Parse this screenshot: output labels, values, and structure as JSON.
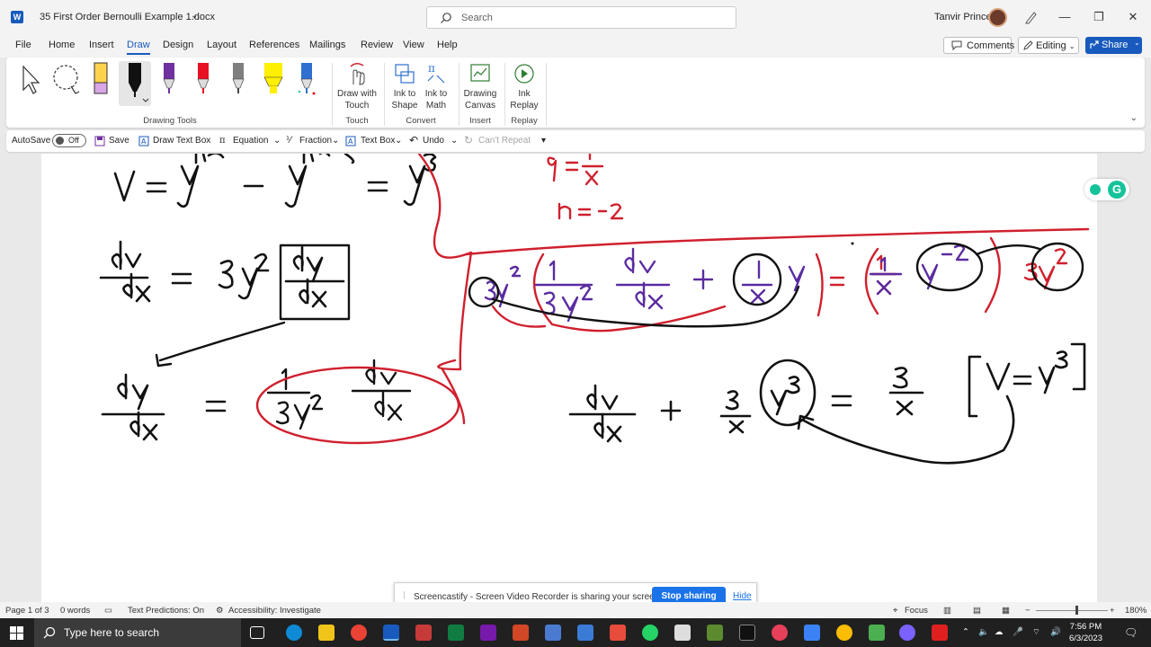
{
  "window": {
    "title": "35 First Order Bernoulli Example 1.docx",
    "search_placeholder": "Search",
    "user_name": "Tanvir Prince"
  },
  "menu": {
    "tabs": [
      "File",
      "Home",
      "Insert",
      "Draw",
      "Design",
      "Layout",
      "References",
      "Mailings",
      "Review",
      "View",
      "Help"
    ],
    "active_tab": "Draw",
    "comments_label": "Comments",
    "editing_label": "Editing",
    "share_label": "Share"
  },
  "ribbon": {
    "groups": {
      "drawing_tools": "Drawing Tools",
      "touch": "Touch",
      "convert": "Convert",
      "insert": "Insert",
      "replay": "Replay"
    },
    "buttons": {
      "draw_with_touch_1": "Draw with",
      "draw_with_touch_2": "Touch",
      "ink_to_shape_1": "Ink to",
      "ink_to_shape_2": "Shape",
      "ink_to_math_1": "Ink to",
      "ink_to_math_2": "Math",
      "drawing_canvas_1": "Drawing",
      "drawing_canvas_2": "Canvas",
      "ink_replay_1": "Ink",
      "ink_replay_2": "Replay"
    },
    "pens": [
      {
        "name": "pen-tool-select",
        "color": "#333333"
      },
      {
        "name": "pen-tool-lasso",
        "color": "#333333"
      },
      {
        "name": "pen-tool-eraser",
        "color": "#f0c0e0"
      },
      {
        "name": "pen-tool-black",
        "color": "#000000"
      },
      {
        "name": "pen-tool-purple",
        "color": "#7030a0"
      },
      {
        "name": "pen-tool-red",
        "color": "#e81123"
      },
      {
        "name": "pen-tool-gray",
        "color": "#7f7f7f"
      },
      {
        "name": "pen-tool-yellow",
        "color": "#ffef00"
      },
      {
        "name": "pen-tool-galaxy",
        "color": "#2f6fd0"
      }
    ]
  },
  "qat": {
    "autosave": "AutoSave",
    "autosave_state": "Off",
    "save": "Save",
    "draw_text_box": "Draw Text Box",
    "equation": "Equation",
    "fraction": "Fraction",
    "text_box": "Text Box",
    "undo": "Undo",
    "cant_repeat": "Can't Repeat"
  },
  "banner": {
    "message": "Screencastify - Screen Video Recorder is sharing your screen.",
    "stop": "Stop sharing",
    "hide": "Hide"
  },
  "status": {
    "page": "Page 1 of 3",
    "words": "0 words",
    "predictions": "Text Predictions: On",
    "accessibility": "Accessibility: Investigate",
    "focus": "Focus",
    "zoom": "180%"
  },
  "taskbar": {
    "search_placeholder": "Type here to search",
    "time": "7:56 PM",
    "date": "6/3/2023"
  },
  "colors": {
    "accent": "#185abd",
    "ink_black": "#111111",
    "ink_red": "#d0202e",
    "ink_purple": "#5a2ca0"
  }
}
